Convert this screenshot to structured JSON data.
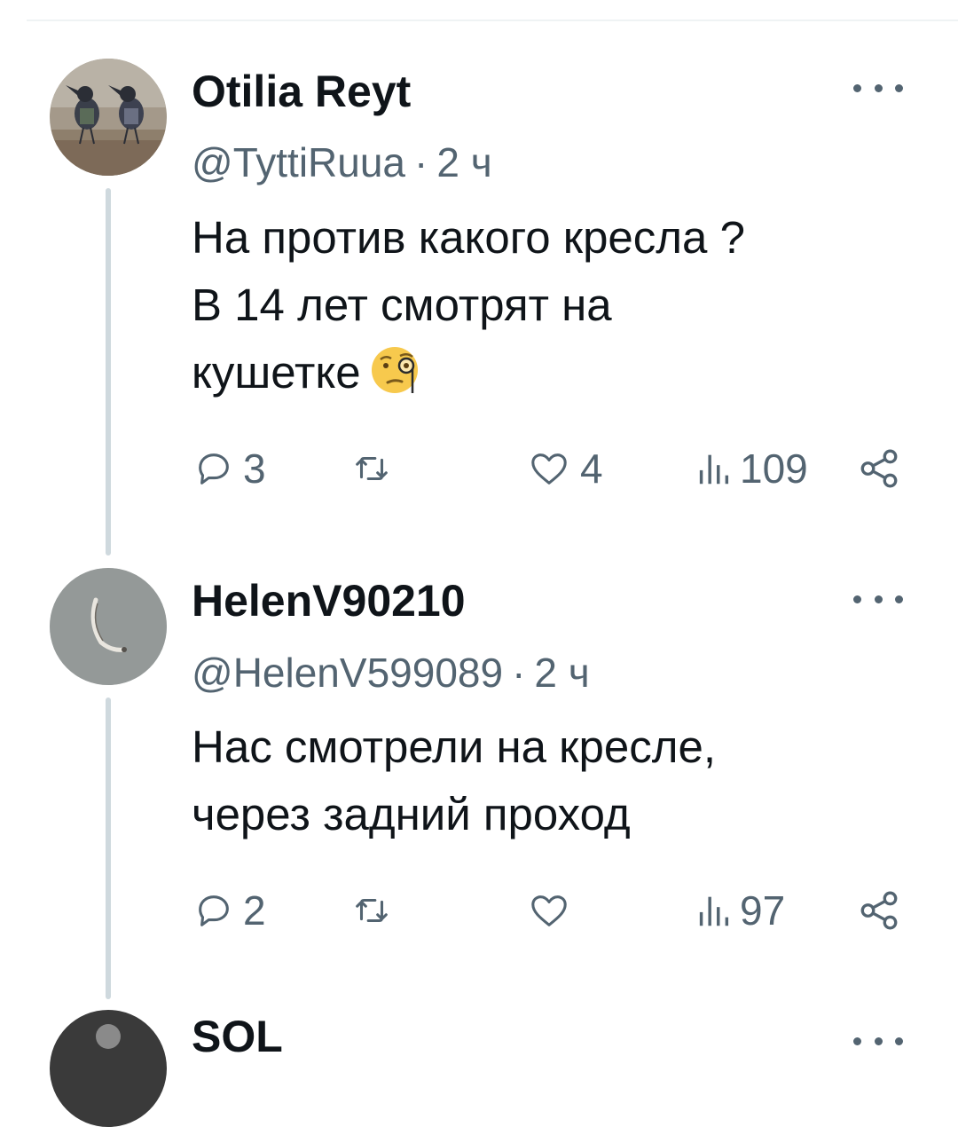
{
  "colors": {
    "text_primary": "#0f1419",
    "text_secondary": "#536471",
    "thread_line": "#cfd9de",
    "divider": "#eff3f4"
  },
  "tweets": [
    {
      "name": "Otilia Reyt",
      "handle": "@TyttiRuua",
      "separator": "·",
      "time": "2 ч",
      "text_lines": [
        "На против какого кресла ?",
        "В 14 лет смотрят на",
        "кушетке"
      ],
      "emoji": "face-with-monocle",
      "replies": "3",
      "retweets": "",
      "likes": "4",
      "views": "109"
    },
    {
      "name": "HelenV90210",
      "handle": "@HelenV599089",
      "separator": "·",
      "time": "2 ч",
      "text_lines": [
        "Нас смотрели на кресле,",
        "через задний проход"
      ],
      "replies": "2",
      "retweets": "",
      "likes": "",
      "views": "97"
    },
    {
      "name": "SOL"
    }
  ]
}
